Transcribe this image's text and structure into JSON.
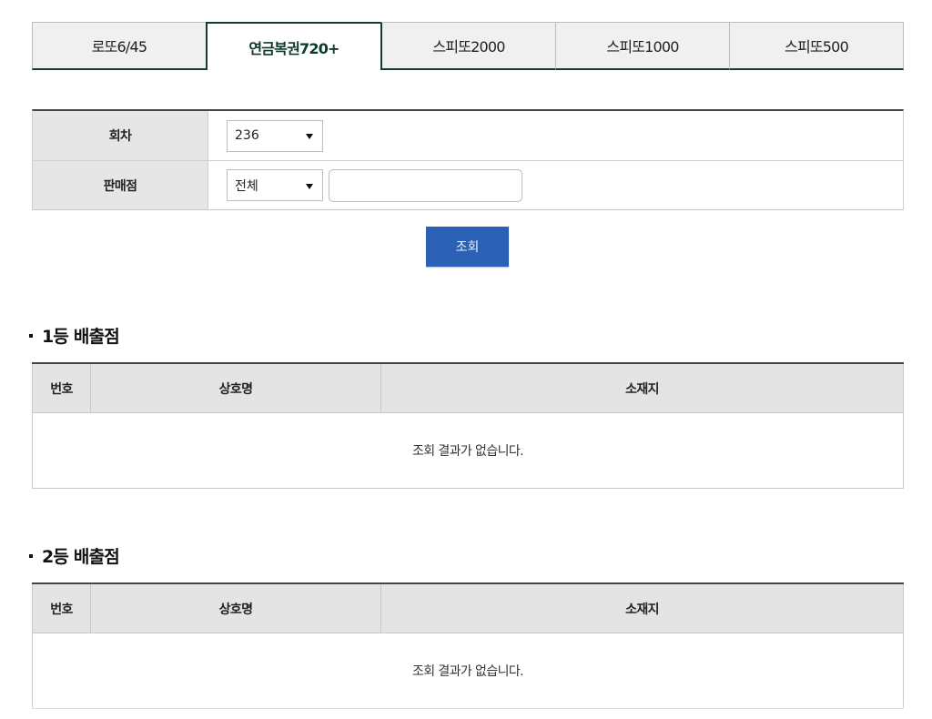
{
  "tabs": [
    {
      "label": "로또6/45",
      "active": false
    },
    {
      "label": "연금복권720+",
      "active": true
    },
    {
      "label": "스피또2000",
      "active": false
    },
    {
      "label": "스피또1000",
      "active": false
    },
    {
      "label": "스피또500",
      "active": false
    }
  ],
  "search_form": {
    "round_label": "회차",
    "round_value": "236",
    "store_label": "판매점",
    "store_select_value": "전체",
    "store_input_value": "",
    "store_input_placeholder": ""
  },
  "search_button_label": "조회",
  "sections": [
    {
      "title": "1등 배출점",
      "columns": [
        "번호",
        "상호명",
        "소재지"
      ],
      "empty_message": "조회 결과가 없습니다."
    },
    {
      "title": "2등 배출점",
      "columns": [
        "번호",
        "상호명",
        "소재지"
      ],
      "empty_message": "조회 결과가 없습니다."
    }
  ],
  "colors": {
    "tab_active_border": "#123c2f",
    "search_button": "#2b60b4",
    "header_bg": "#e4e4e4"
  }
}
